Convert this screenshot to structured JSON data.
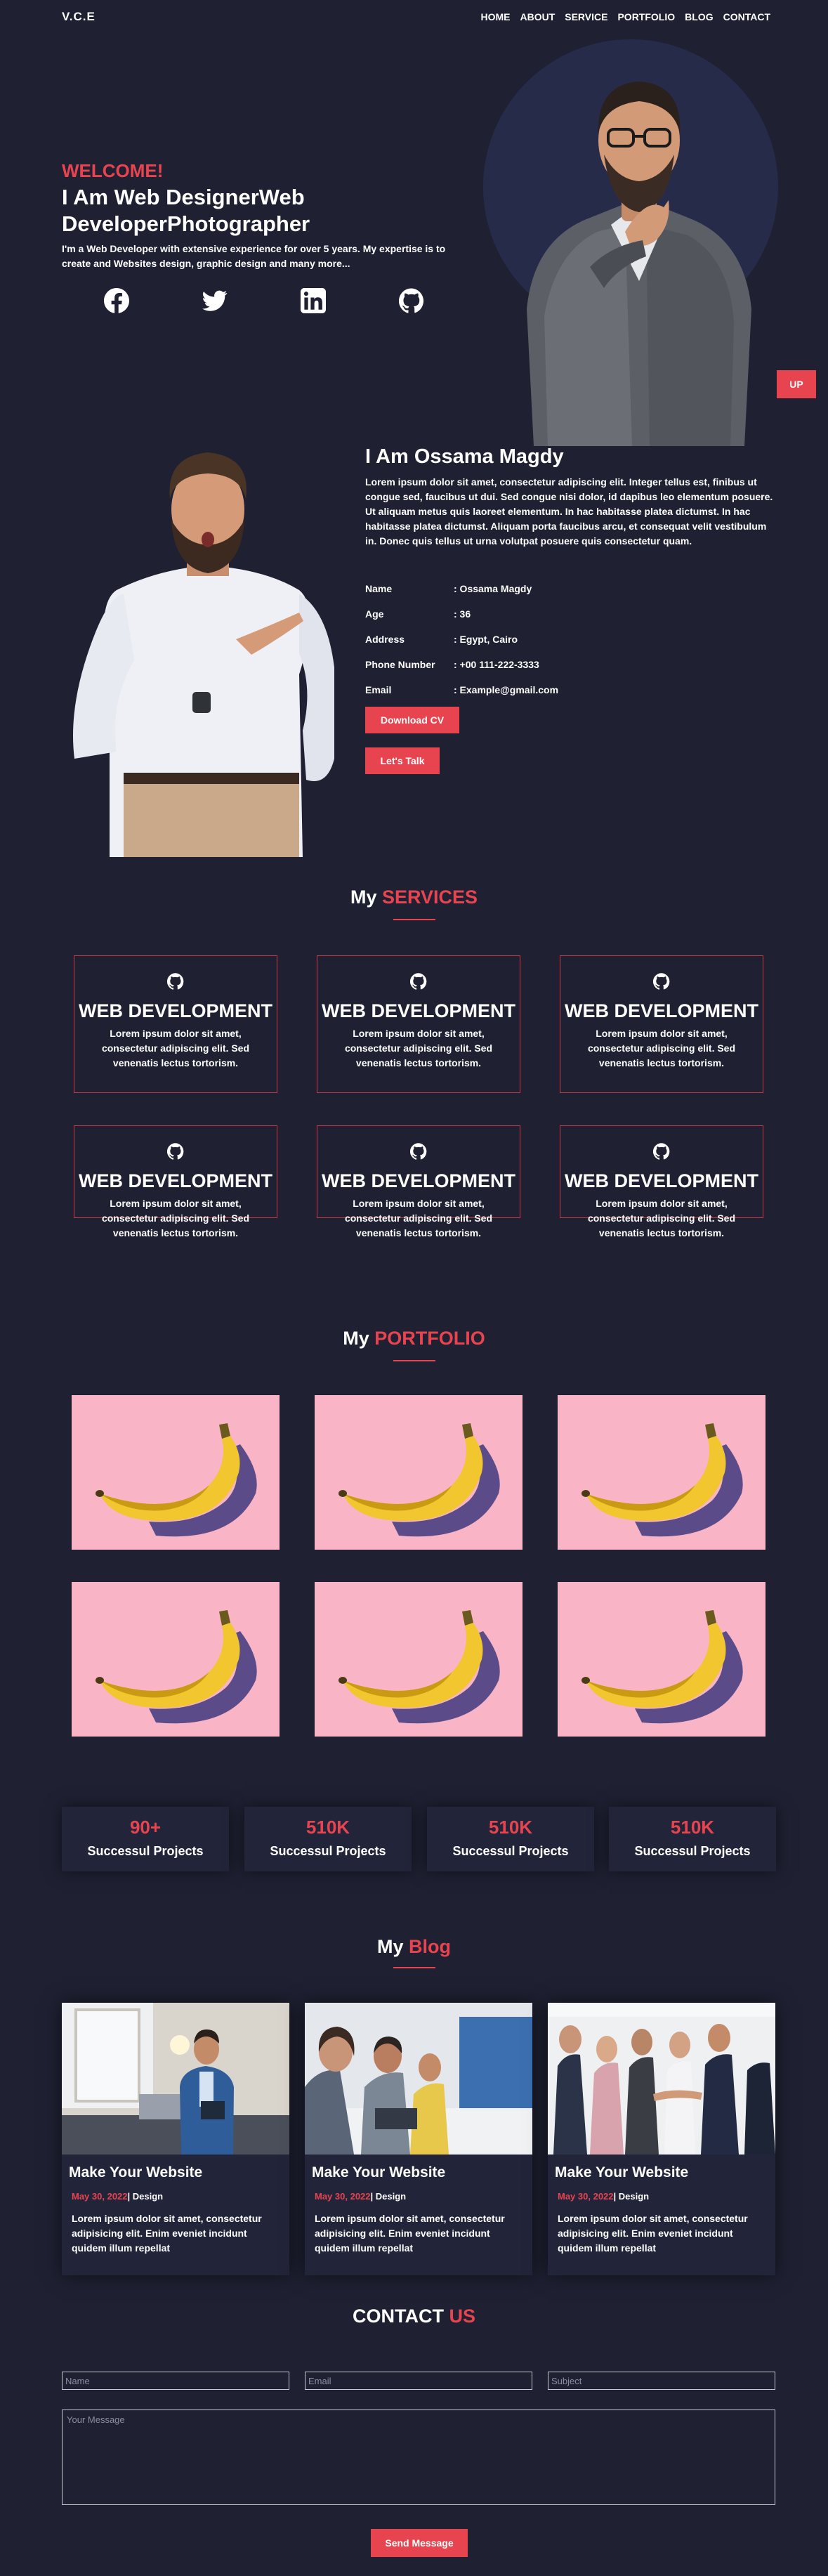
{
  "nav": {
    "logo": "V.C.E",
    "items": [
      "HOME",
      "ABOUT",
      "SERVICE",
      "PORTFOLIO",
      "BLOG",
      "CONTACT"
    ]
  },
  "hero": {
    "welcome": "WELCOME!",
    "title": "I Am Web DesignerWeb DeveloperPhotographer",
    "text": "I'm a Web Developer with extensive experience for over 5 years. My expertise is to create and Websites design, graphic design and many more...",
    "socials": [
      "facebook-icon",
      "twitter-icon",
      "linkedin-icon",
      "github-icon"
    ]
  },
  "up_label": "UP",
  "about": {
    "title": "I Am Ossama Magdy",
    "text": "Lorem ipsum dolor sit amet, consectetur adipiscing elit. Integer tellus est, finibus ut congue sed, faucibus ut dui. Sed congue nisi dolor, id dapibus leo elementum posuere. Ut aliquam metus quis laoreet elementum. In hac habitasse platea dictumst. In hac habitasse platea dictumst. Aliquam porta faucibus arcu, et consequat velit vestibulum in. Donec quis tellus ut urna volutpat posuere quis consectetur quam.",
    "info": [
      {
        "key": "Name",
        "value": ": Ossama Magdy"
      },
      {
        "key": "Age",
        "value": ": 36"
      },
      {
        "key": "Address",
        "value": ": Egypt, Cairo"
      },
      {
        "key": "Phone Number",
        "value": ": +00 111-222-3333"
      },
      {
        "key": "Email",
        "value": ": Example@gmail.com"
      }
    ],
    "download_label": "Download CV",
    "talk_label": "Let's Talk"
  },
  "services": {
    "title_prefix": "My ",
    "title_accent": "SERVICES",
    "items": [
      {
        "title": "WEB DEVELOPMENT",
        "text": "Lorem ipsum dolor sit amet, consectetur adipiscing elit. Sed venenatis lectus tortorism."
      },
      {
        "title": "WEB DEVELOPMENT",
        "text": "Lorem ipsum dolor sit amet, consectetur adipiscing elit. Sed venenatis lectus tortorism."
      },
      {
        "title": "WEB DEVELOPMENT",
        "text": "Lorem ipsum dolor sit amet, consectetur adipiscing elit. Sed venenatis lectus tortorism."
      },
      {
        "title": "WEB DEVELOPMENT",
        "text": "Lorem ipsum dolor sit amet, consectetur adipiscing elit. Sed venenatis lectus tortorism."
      },
      {
        "title": "WEB DEVELOPMENT",
        "text": "Lorem ipsum dolor sit amet, consectetur adipiscing elit. Sed venenatis lectus tortorism."
      },
      {
        "title": "WEB DEVELOPMENT",
        "text": "Lorem ipsum dolor sit amet, consectetur adipiscing elit. Sed venenatis lectus tortorism."
      }
    ]
  },
  "portfolio": {
    "title_prefix": "My ",
    "title_accent": "PORTFOLIO"
  },
  "stats": [
    {
      "num": "90+",
      "label": "Successul Projects"
    },
    {
      "num": "510K",
      "label": "Successul Projects"
    },
    {
      "num": "510K",
      "label": "Successul Projects"
    },
    {
      "num": "510K",
      "label": "Successul Projects"
    }
  ],
  "blog": {
    "title_prefix": "My ",
    "title_accent": "Blog",
    "posts": [
      {
        "title": "Make Your Website",
        "date": "May 30, 2022",
        "category": "| Design",
        "text": "Lorem ipsum dolor sit amet, consectetur adipisicing elit. Enim eveniet incidunt quidem illum repellat"
      },
      {
        "title": "Make Your Website",
        "date": "May 30, 2022",
        "category": "| Design",
        "text": "Lorem ipsum dolor sit amet, consectetur adipisicing elit. Enim eveniet incidunt quidem illum repellat"
      },
      {
        "title": "Make Your Website",
        "date": "May 30, 2022",
        "category": "| Design",
        "text": "Lorem ipsum dolor sit amet, consectetur adipisicing elit. Enim eveniet incidunt quidem illum repellat"
      }
    ]
  },
  "contact": {
    "title_prefix": "CONTACT ",
    "title_accent": "US",
    "name_placeholder": "Name",
    "email_placeholder": "Email",
    "subject_placeholder": "Subject",
    "message_placeholder": "Your Message",
    "send_label": "Send Message"
  },
  "colors": {
    "background": "#1f2133",
    "accent": "#e8444f",
    "portfolio_bg": "#f9b4c5"
  }
}
